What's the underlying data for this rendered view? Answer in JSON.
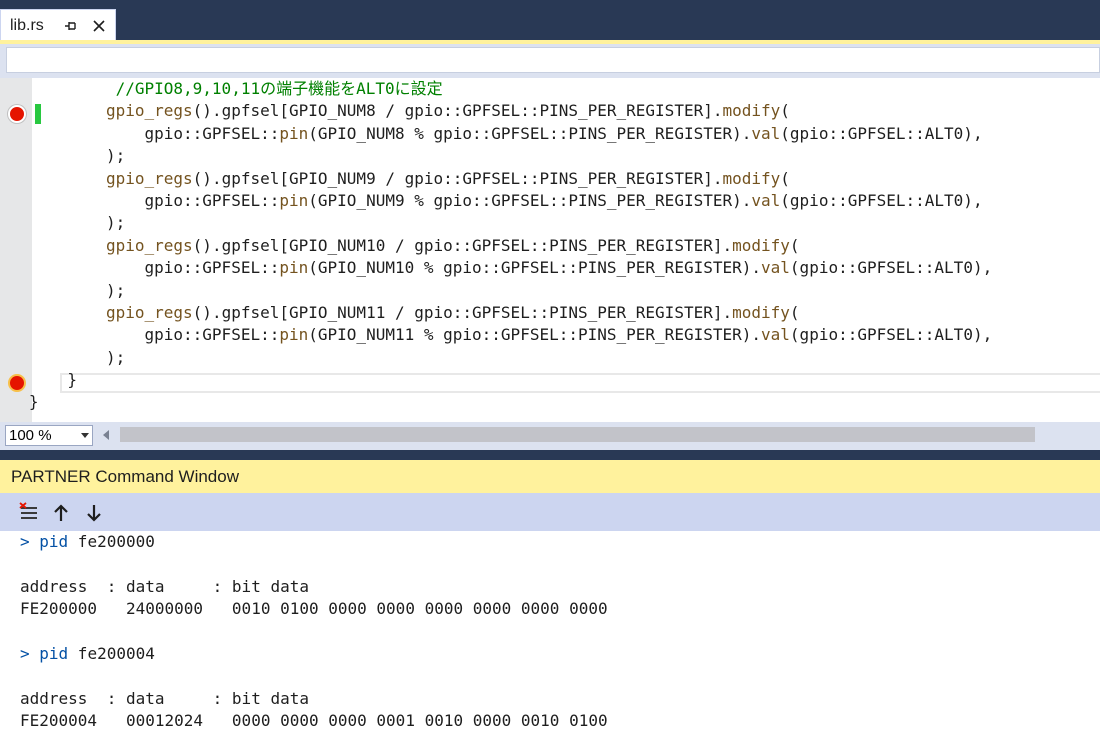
{
  "tab": {
    "title": "lib.rs"
  },
  "editor": {
    "lines": [
      {
        "segments": [
          {
            "t": "            "
          },
          {
            "t": "//GPIO8,9,10,11の端子機能をALT0に設定",
            "c": "cm"
          }
        ]
      },
      {
        "segments": [
          {
            "t": "           "
          },
          {
            "t": "gpio_regs",
            "c": "fn"
          },
          {
            "t": "().gpfsel[GPIO_NUM8 / gpio::GPFSEL::PINS_PER_REGISTER]."
          },
          {
            "t": "modify",
            "c": "fn"
          },
          {
            "t": "("
          }
        ]
      },
      {
        "segments": [
          {
            "t": "               gpio::GPFSEL::"
          },
          {
            "t": "pin",
            "c": "fn"
          },
          {
            "t": "(GPIO_NUM8 % gpio::GPFSEL::PINS_PER_REGISTER)."
          },
          {
            "t": "val",
            "c": "fn"
          },
          {
            "t": "(gpio::GPFSEL::ALT0),"
          }
        ]
      },
      {
        "segments": [
          {
            "t": "           );"
          }
        ]
      },
      {
        "segments": [
          {
            "t": "           "
          },
          {
            "t": "gpio_regs",
            "c": "fn"
          },
          {
            "t": "().gpfsel[GPIO_NUM9 / gpio::GPFSEL::PINS_PER_REGISTER]."
          },
          {
            "t": "modify",
            "c": "fn"
          },
          {
            "t": "("
          }
        ]
      },
      {
        "segments": [
          {
            "t": "               gpio::GPFSEL::"
          },
          {
            "t": "pin",
            "c": "fn"
          },
          {
            "t": "(GPIO_NUM9 % gpio::GPFSEL::PINS_PER_REGISTER)."
          },
          {
            "t": "val",
            "c": "fn"
          },
          {
            "t": "(gpio::GPFSEL::ALT0),"
          }
        ]
      },
      {
        "segments": [
          {
            "t": "           );"
          }
        ]
      },
      {
        "segments": [
          {
            "t": "           "
          },
          {
            "t": "gpio_regs",
            "c": "fn"
          },
          {
            "t": "().gpfsel[GPIO_NUM10 / gpio::GPFSEL::PINS_PER_REGISTER]."
          },
          {
            "t": "modify",
            "c": "fn"
          },
          {
            "t": "("
          }
        ]
      },
      {
        "segments": [
          {
            "t": "               gpio::GPFSEL::"
          },
          {
            "t": "pin",
            "c": "fn"
          },
          {
            "t": "(GPIO_NUM10 % gpio::GPFSEL::PINS_PER_REGISTER)."
          },
          {
            "t": "val",
            "c": "fn"
          },
          {
            "t": "(gpio::GPFSEL::ALT0),"
          }
        ]
      },
      {
        "segments": [
          {
            "t": "           );"
          }
        ]
      },
      {
        "segments": [
          {
            "t": "           "
          },
          {
            "t": "gpio_regs",
            "c": "fn"
          },
          {
            "t": "().gpfsel[GPIO_NUM11 / gpio::GPFSEL::PINS_PER_REGISTER]."
          },
          {
            "t": "modify",
            "c": "fn"
          },
          {
            "t": "("
          }
        ]
      },
      {
        "segments": [
          {
            "t": "               gpio::GPFSEL::"
          },
          {
            "t": "pin",
            "c": "fn"
          },
          {
            "t": "(GPIO_NUM11 % gpio::GPFSEL::PINS_PER_REGISTER)."
          },
          {
            "t": "val",
            "c": "fn"
          },
          {
            "t": "(gpio::GPFSEL::ALT0),"
          }
        ]
      },
      {
        "segments": [
          {
            "t": "           );"
          }
        ]
      },
      {
        "segments": [
          {
            "t": "       }"
          }
        ]
      },
      {
        "segments": [
          {
            "t": "   }"
          }
        ]
      }
    ]
  },
  "zoom": {
    "value": "100 %"
  },
  "command_window": {
    "title": "PARTNER Command Window",
    "lines": [
      {
        "segments": [
          {
            "t": "> pid",
            "c": "prompt"
          },
          {
            "t": " fe200000"
          }
        ]
      },
      {
        "segments": [
          {
            "t": ""
          }
        ]
      },
      {
        "segments": [
          {
            "t": "address  : data     : bit data"
          }
        ]
      },
      {
        "segments": [
          {
            "t": "FE200000   24000000   0010 0100 0000 0000 0000 0000 0000 0000"
          }
        ]
      },
      {
        "segments": [
          {
            "t": ""
          }
        ]
      },
      {
        "segments": [
          {
            "t": "> pid",
            "c": "prompt"
          },
          {
            "t": " fe200004"
          }
        ]
      },
      {
        "segments": [
          {
            "t": ""
          }
        ]
      },
      {
        "segments": [
          {
            "t": "address  : data     : bit data"
          }
        ]
      },
      {
        "segments": [
          {
            "t": "FE200004   00012024   0000 0000 0000 0001 0010 0000 0010 0100"
          }
        ]
      }
    ]
  },
  "colors": {
    "accent": "#fff29d",
    "frame": "#293955",
    "breakpoint": "#e51400",
    "comment": "#008000",
    "function": "#74531f",
    "prompt": "#0451a5"
  }
}
